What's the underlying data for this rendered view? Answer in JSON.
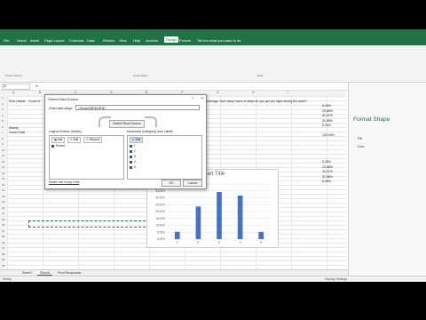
{
  "ribbon": {
    "tabs": [
      "File",
      "Home",
      "Insert",
      "Page Layout",
      "Formulas",
      "Data",
      "Review",
      "View",
      "Help",
      "Acrobat",
      "Design",
      "Format"
    ],
    "active_tab": "Design",
    "tell_me": "Tell me what you want to do",
    "groups": [
      "Chart Layouts",
      "Chart Styles",
      "Data"
    ]
  },
  "formula_bar": {
    "name_box": "J3",
    "fx": "fx"
  },
  "columns": [
    "A",
    "B",
    "C",
    "D",
    "E",
    "F",
    "G",
    "H",
    "I"
  ],
  "rows": [
    "1",
    "2",
    "3",
    "4",
    "5",
    "6",
    "7",
    "8",
    "9",
    "10",
    "11",
    "12",
    "13",
    "14",
    "15",
    "16",
    "17",
    "18",
    "19",
    "20",
    "21",
    "22",
    "23",
    "24",
    "25",
    "26",
    "27",
    "28",
    "29",
    "30"
  ],
  "cells": {
    "row_labels": "Row Labels",
    "count_of": "Count of",
    "question": "average, how many hours of sleep do you get per night during the week?",
    "blank": "(blank)",
    "grand_total": "Grand Total",
    "pcts_top": [
      "5.26%",
      "23.68%",
      "34.21%",
      "31.58%",
      "5.26%",
      "",
      "100.00%"
    ],
    "pcts_bottom": [
      "5.26%",
      "23.68%",
      "34.21%",
      "31.58%",
      "5.26%"
    ]
  },
  "dialog": {
    "title": "Select Data Source",
    "help": "?",
    "close": "×",
    "range_label": "Chart data range:",
    "range_value": "=Sheet2!$F$3:$F$7",
    "switch_label": "Switch Row/Column",
    "legend_label": "Legend Entries (Series)",
    "axis_label": "Horizontal (Category) Axis Labels",
    "add": "Add",
    "edit": "Edit",
    "remove": "Remove",
    "axis_edit": "Edit",
    "series": [
      "Series1"
    ],
    "categories": [
      "1",
      "2",
      "3",
      "4",
      "5"
    ],
    "hidden_cells": "Hidden and Empty Cells",
    "ok": "OK",
    "cancel": "Cancel"
  },
  "format_pane": {
    "title": "Format Shape",
    "fill": "Fill",
    "line": "Line"
  },
  "sheet_tabs": [
    "Sheet1",
    "Sheet2",
    "Pivot Responses"
  ],
  "active_sheet": "Sheet2",
  "status": {
    "mode": "Ready",
    "right": "Display Settings"
  },
  "chart_data": {
    "type": "bar",
    "title": "Chart Title",
    "categories": [
      "1",
      "2",
      "3",
      "4",
      "5"
    ],
    "values": [
      5.26,
      23.68,
      34.21,
      31.58,
      5.26
    ],
    "ylim": [
      0,
      40
    ],
    "yticks": [
      "0.00%",
      "5.00%",
      "10.00%",
      "15.00%",
      "20.00%",
      "25.00%",
      "30.00%",
      "35.00%",
      "40.00%"
    ],
    "color": "#4472c4",
    "grid": true
  },
  "colors": {
    "excel_green": "#217346",
    "bar": "#4472c4"
  }
}
